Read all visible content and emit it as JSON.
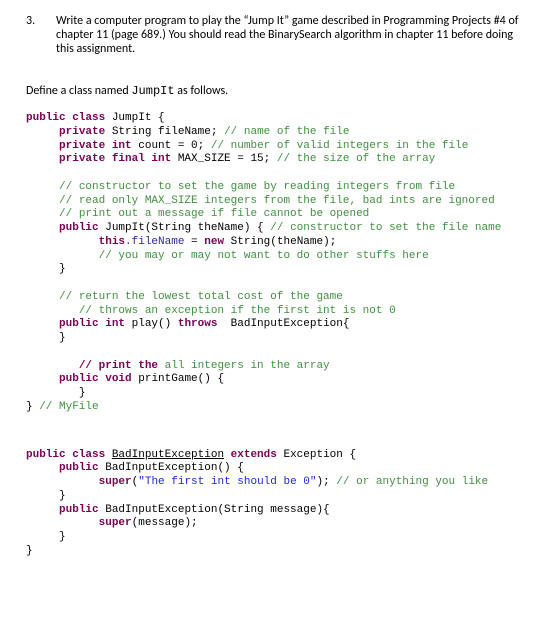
{
  "question": {
    "number": "3.",
    "text": "Write a computer program to play the “Jump It” game described in Programming Projects #4 of chapter 11 (page 689.)  You should read the BinarySearch algorithm in chapter 11 before doing this assignment."
  },
  "define_line_pre": "Define a class named ",
  "define_classname": "JumpIt",
  "define_line_post": " as follows.",
  "code1": {
    "l1_kw1": "public class",
    "l1_cls": " JumpIt {",
    "l2_kw": "private",
    "l2_rest": " String fileName; ",
    "l2_cmt": "// name of the file",
    "l3_kw": "private int",
    "l3_rest": " count = 0; ",
    "l3_cmt": "// number of valid integers in the file",
    "l4_kw": "private final int",
    "l4_rest": " MAX_SIZE = 15; ",
    "l4_cmt": "// the size of the array",
    "l5_cmt": "// constructor to set the game by reading integers from file",
    "l6_cmt": "// read only MAX_SIZE integers from the file, bad ints are ignored",
    "l7_cmt": "// print out a message if file cannot be opened",
    "l8_kw": "public",
    "l8_mid": " JumpIt(String theName) { ",
    "l8_cmt": "// constructor to set the file name",
    "l9_kw": "this",
    "l9_fld": ".fileName",
    "l9_mid": " = ",
    "l9_kw2": "new",
    "l9_end": " String(theName);",
    "l10_cmt": "// you may or may not want to do other stuffs here",
    "l11": "}",
    "l12_cmt": "// return the lowest total cost of the game",
    "l13_cmt": "// throws an exception if the first int is not 0",
    "l14_kw1": "public int",
    "l14_mid": " play() ",
    "l14_kw2": "throws",
    "l14_end": "  BadInputException{",
    "l15": "}",
    "l16_kw": "// print the",
    "l16_cmt": " all integers in the array",
    "l17_kw": "public void",
    "l17_rest": " printGame() {",
    "l18": "}",
    "l19_a": "} ",
    "l19_cmt": "// MyFile"
  },
  "code2": {
    "l1_kw": "public class",
    "l1_mid": " ",
    "l1_ul": "BadInputException",
    "l1_sp": " ",
    "l1_kw2": "extends",
    "l1_end": " Exception {",
    "l2_kw": "public",
    "l2_rest": " BadInputException() {",
    "l3_kw": "super",
    "l3_p1": "(",
    "l3_str": "\"The first int should be 0\"",
    "l3_p2": "); ",
    "l3_cmt": "// or anything you like",
    "l4": "}",
    "l5_kw": "public",
    "l5_rest": " BadInputException(String message){",
    "l6_kw": "super",
    "l6_rest": "(message);",
    "l7": "}",
    "l8": "}"
  }
}
